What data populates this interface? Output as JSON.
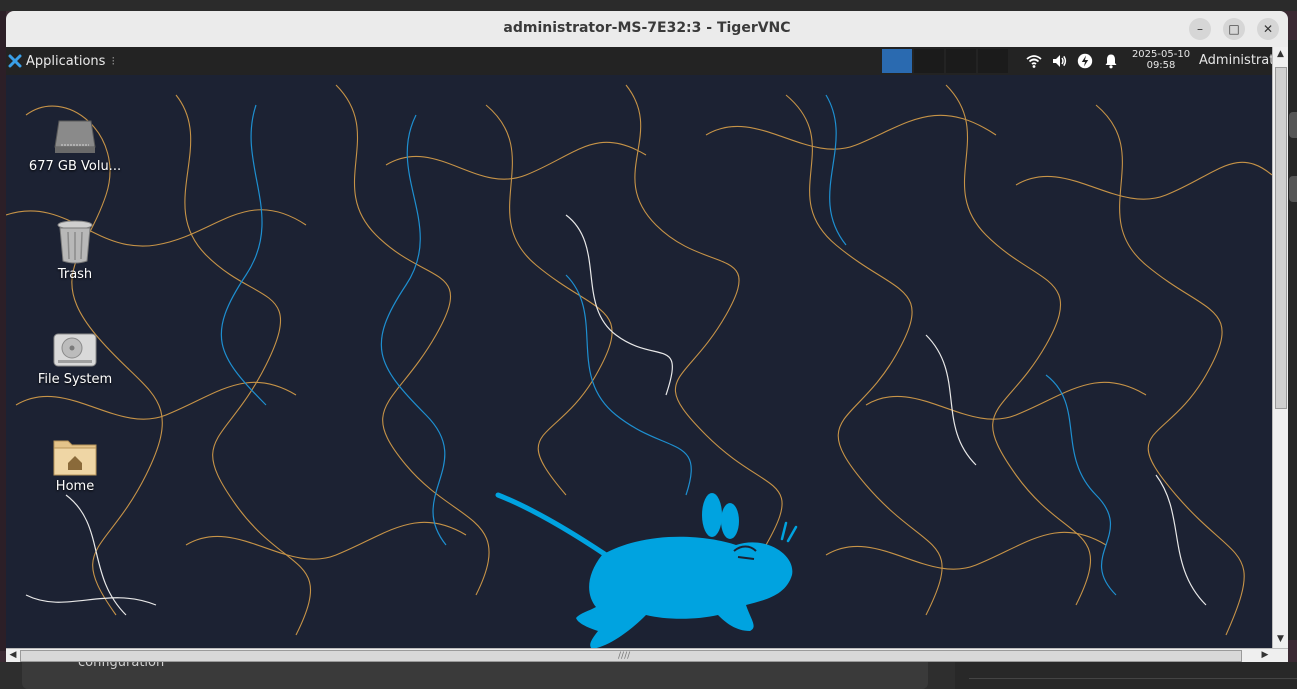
{
  "window": {
    "title": "administrator-MS-7E32:3 - TigerVNC",
    "min_glyph": "–",
    "max_glyph": "□",
    "close_glyph": "✕"
  },
  "panel": {
    "applications_label": "Applications",
    "applications_sep": "⁝",
    "clock_date": "2025-05-10",
    "clock_time": "09:58",
    "user_label": "Administrat",
    "tray_icons": [
      "wifi-icon",
      "volume-icon",
      "power-icon",
      "notification-bell-icon"
    ],
    "active_workspace": 1
  },
  "desktop": {
    "icons": [
      {
        "label": "677 GB Volu...",
        "icon": "drive-icon"
      },
      {
        "label": "Trash",
        "icon": "trash-icon"
      },
      {
        "label": "File System",
        "icon": "hard-disk-icon"
      },
      {
        "label": "Home",
        "icon": "home-folder-icon"
      }
    ]
  },
  "host": {
    "background_text": "configuration"
  },
  "colors": {
    "wallpaper_bg": "#1c2233",
    "mouse_blue": "#00a3e0",
    "line_orange": "#d9a04a",
    "line_blue": "#1e8fd0",
    "line_white": "#e8e8e8"
  }
}
